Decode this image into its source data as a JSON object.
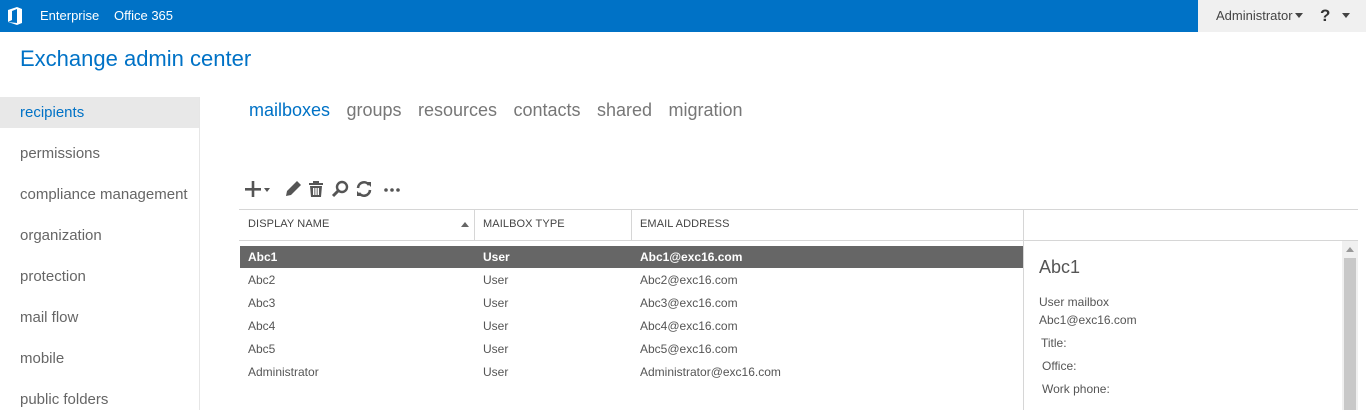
{
  "topbar": {
    "nav": [
      "Enterprise",
      "Office 365"
    ],
    "user": "Administrator",
    "help": "?"
  },
  "app_title": "Exchange admin center",
  "leftnav": [
    "recipients",
    "permissions",
    "compliance management",
    "organization",
    "protection",
    "mail flow",
    "mobile",
    "public folders"
  ],
  "tabs": [
    "mailboxes",
    "groups",
    "resources",
    "contacts",
    "shared",
    "migration"
  ],
  "toolbar": [
    "add-icon",
    "edit-icon",
    "delete-icon",
    "search-icon",
    "refresh-icon",
    "more-icon"
  ],
  "table": {
    "columns": [
      "DISPLAY NAME",
      "MAILBOX TYPE",
      "EMAIL ADDRESS"
    ],
    "sort_column": "DISPLAY NAME",
    "sort_order": "ascending",
    "rows": [
      [
        "Abc1",
        "User",
        "Abc1@exc16.com"
      ],
      [
        "Abc2",
        "User",
        "Abc2@exc16.com"
      ],
      [
        "Abc3",
        "User",
        "Abc3@exc16.com"
      ],
      [
        "Abc4",
        "User",
        "Abc4@exc16.com"
      ],
      [
        "Abc5",
        "User",
        "Abc5@exc16.com"
      ],
      [
        "Administrator",
        "User",
        "Administrator@exc16.com"
      ]
    ],
    "selected_row": "Abc1"
  },
  "details": {
    "name": "Abc1",
    "type": "User mailbox",
    "email": "Abc1@exc16.com",
    "title_label": "Title:",
    "office_label": "Office:",
    "phone_label": "Work phone:"
  },
  "colors": {
    "brand": "#0072c6",
    "selected_row": "#666666"
  }
}
